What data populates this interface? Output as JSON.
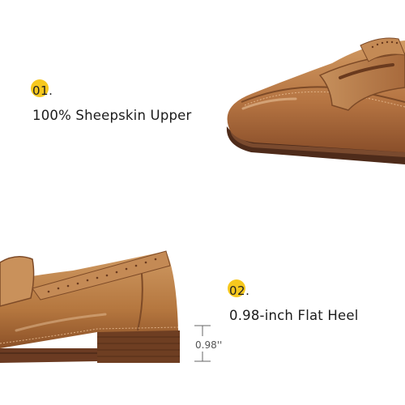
{
  "features": [
    {
      "number": "01.",
      "text": "100% Sheepskin Upper"
    },
    {
      "number": "02.",
      "text": "0.98-inch Flat Heel"
    }
  ],
  "heel_measurement": "0.98''",
  "colors": {
    "accent": "#f6c81e",
    "leather": "#b87844",
    "sole": "#5a3220",
    "background": "#ffffff"
  }
}
